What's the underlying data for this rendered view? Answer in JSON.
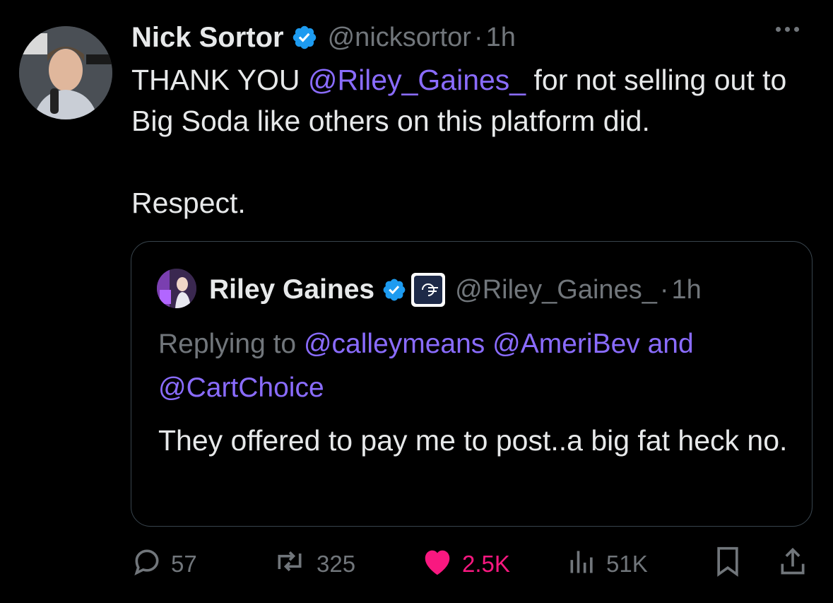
{
  "tweet": {
    "author_name": "Nick Sortor",
    "author_handle": "@nicksortor",
    "separator": "·",
    "time": "1h",
    "text_before_mention": "THANK YOU ",
    "mention": "@Riley_Gaines_",
    "text_after_mention": " for not selling out to Big Soda like others on this platform did.",
    "text_line2": "Respect."
  },
  "quote": {
    "author_name": "Riley Gaines",
    "author_handle": "@Riley_Gaines_",
    "separator": "·",
    "time": "1h",
    "replying_label": "Replying to ",
    "replying_mentions": "@calleymeans @AmeriBev and @CartChoice",
    "text": "They offered to pay me to post..a big fat heck no."
  },
  "actions": {
    "replies": "57",
    "reposts": "325",
    "likes": "2.5K",
    "views": "51K"
  },
  "colors": {
    "background": "#000000",
    "text": "#e7e9ea",
    "muted": "#71767b",
    "mention": "#8a6cff",
    "verified": "#1d9bf0",
    "like": "#f91880"
  },
  "icons": {
    "verified": "verified-badge-icon",
    "more": "more-icon",
    "reply": "reply-icon",
    "repost": "repost-icon",
    "like": "heart-icon",
    "views": "views-icon",
    "bookmark": "bookmark-icon",
    "share": "share-icon"
  }
}
